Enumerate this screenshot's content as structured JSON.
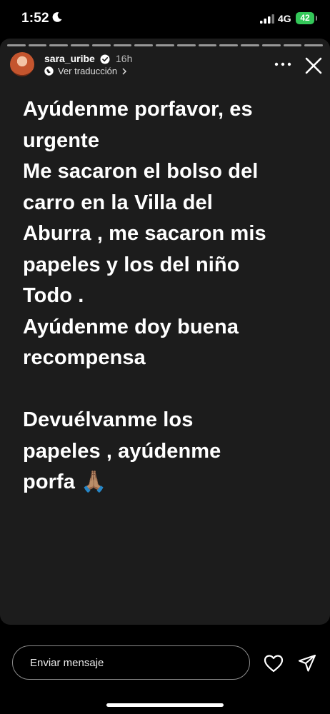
{
  "status_bar": {
    "time": "1:52",
    "network": "4G",
    "battery": "42"
  },
  "story": {
    "username": "sara_uribe",
    "time_ago": "16h",
    "translate_label": "Ver traducción",
    "progress_segments": 15,
    "caption": "Ayúdenme porfavor, es\nurgente\nMe sacaron el bolso del\ncarro en la Villa del\nAburra , me sacaron mis\npapeles y los del niño\nTodo .\nAyúdenme doy buena\nrecompensa\n\nDevuélvanme los\npapeles , ayúdenme\nporfa 🙏🏽"
  },
  "reply": {
    "placeholder": "Enviar mensaje"
  },
  "colors": {
    "story_bg": "#1c1c1c",
    "battery_green": "#34c759",
    "verified_blue": "#0095f6"
  }
}
